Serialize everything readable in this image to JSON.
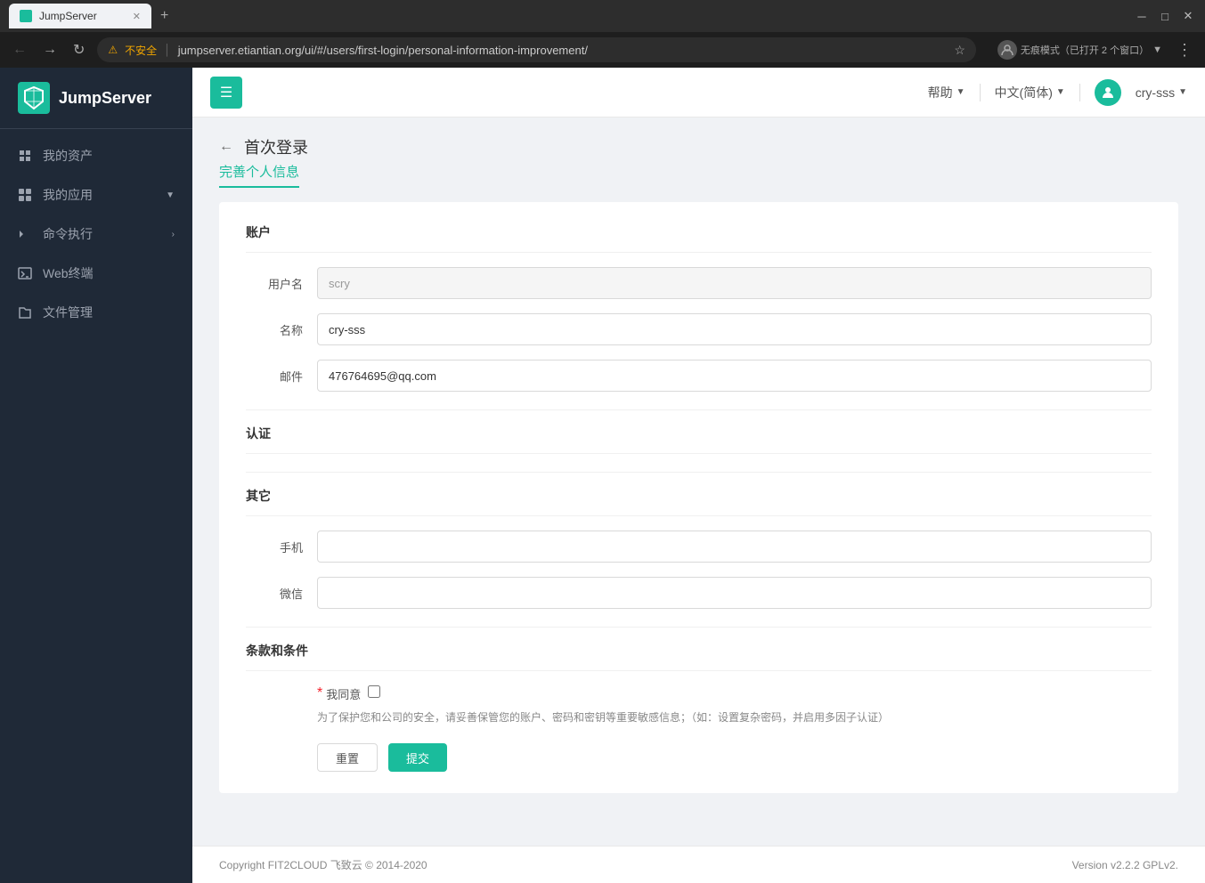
{
  "browser": {
    "tab_title": "JumpServer",
    "tab_favicon": "JS",
    "address": "jumpserver.etiantian.org/ui/#/users/first-login/personal-information-improvement/",
    "security_label": "不安全",
    "incognito_label": "无痕模式（已打开 2 个窗口）"
  },
  "sidebar": {
    "logo_text": "JumpServer",
    "items": [
      {
        "label": "我的资产",
        "icon": "asset-icon"
      },
      {
        "label": "我的应用",
        "icon": "app-icon",
        "has_arrow": true
      },
      {
        "label": "命令执行",
        "icon": "cmd-icon",
        "has_arrow": true
      },
      {
        "label": "Web终端",
        "icon": "web-icon"
      },
      {
        "label": "文件管理",
        "icon": "file-icon"
      }
    ]
  },
  "header": {
    "help_label": "帮助",
    "language_label": "中文(简体)",
    "username": "cry-sss"
  },
  "page": {
    "back_label": "←",
    "title": "首次登录",
    "subtitle": "完善个人信息",
    "sections": {
      "account": {
        "title": "账户",
        "fields": {
          "username_label": "用户名",
          "username_value": "scry",
          "name_label": "名称",
          "name_value": "cry-sss",
          "email_label": "邮件",
          "email_value": "476764695@qq.com"
        }
      },
      "auth": {
        "title": "认证"
      },
      "other": {
        "title": "其它",
        "fields": {
          "phone_label": "手机",
          "phone_value": "",
          "phone_placeholder": "",
          "wechat_label": "微信",
          "wechat_value": "",
          "wechat_placeholder": ""
        }
      },
      "terms": {
        "title": "条款和条件",
        "agree_label": "我同意",
        "notice": "为了保护您和公司的安全，请妥善保管您的账户、密码和密钥等重要敏感信息；（如：设置复杂密码，并启用多因子认证）"
      }
    },
    "buttons": {
      "reset_label": "重置",
      "submit_label": "提交"
    }
  },
  "footer": {
    "copyright": "Copyright FIT2CLOUD 飞致云 © 2014-2020",
    "version": "Version v2.2.2 GPLv2."
  }
}
